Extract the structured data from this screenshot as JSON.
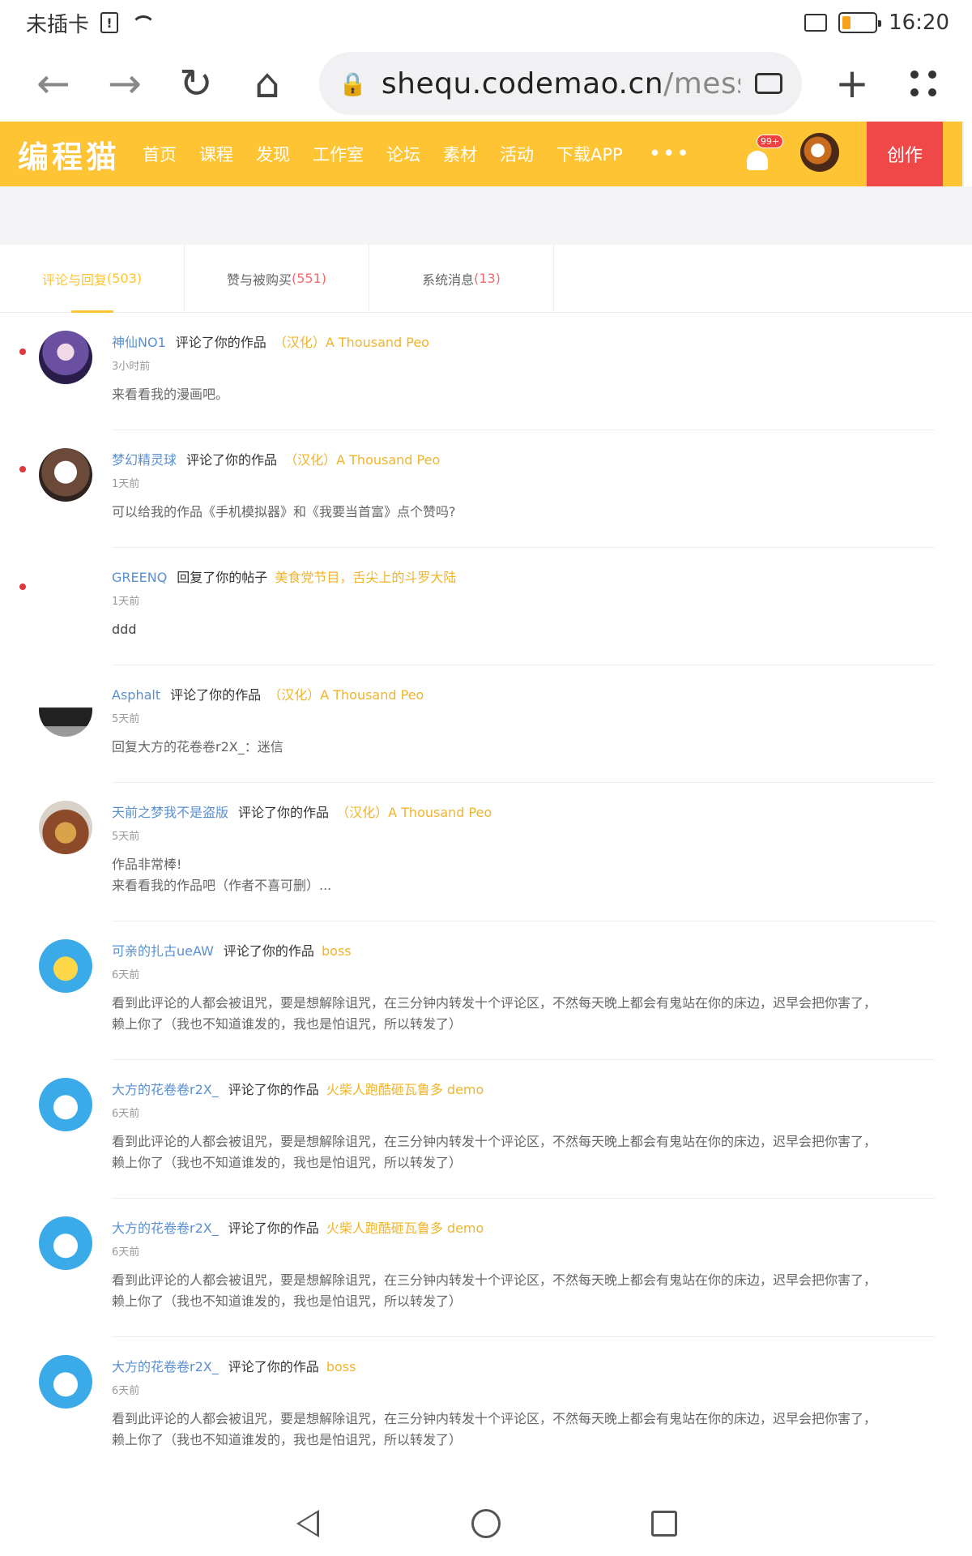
{
  "status_bar": {
    "carrier": "未插卡",
    "time": "16:20",
    "battery_fraction": 0.25
  },
  "browser": {
    "url_host": "shequ.codemao.cn",
    "url_path": "/messag"
  },
  "site_nav": {
    "logo": "编程猫",
    "items": [
      "首页",
      "课程",
      "发现",
      "工作室",
      "论坛",
      "素材",
      "活动",
      "下载APP"
    ],
    "more": "•••",
    "badge": "99+",
    "create": "创作"
  },
  "tabs": [
    {
      "label": "评论与回复",
      "count": "(503)"
    },
    {
      "label": "赞与被购买",
      "count": "(551)"
    },
    {
      "label": "系统消息",
      "count": "(13)"
    }
  ],
  "messages": [
    {
      "user": "神仙NO1",
      "action": "评论了你的作品",
      "target": "（汉化）A Thousand Peo",
      "time": "3小时前",
      "body": [
        "来看看我的漫画吧。"
      ],
      "unread": true,
      "avatar": "anime-avatar"
    },
    {
      "user": "梦幻精灵球",
      "action": "评论了你的作品",
      "target": "（汉化）A Thousand Peo",
      "time": "1天前",
      "body": [
        "可以给我的作品《手机模拟器》和《我要当首富》点个赞吗?"
      ],
      "unread": true,
      "avatar": "cartoon-avatar"
    },
    {
      "user": "GREENQ",
      "action": "回复了你的帖子",
      "target": "美食党节目，舌尖上的斗罗大陆",
      "time": "1天前",
      "body": [
        "ddd"
      ],
      "unread": true,
      "avatar": "none"
    },
    {
      "user": "Asphalt",
      "action": "评论了你的作品",
      "target": "（汉化）A Thousand Peo",
      "time": "5天前",
      "body": [
        "回复大方的花卷卷r2X_：迷信"
      ],
      "unread": false,
      "avatar": "asphalt-avatar"
    },
    {
      "user": "天前之梦我不是盗版",
      "action": "评论了你的作品",
      "target": "（汉化）A Thousand Peo",
      "time": "5天前",
      "body": [
        "作品非常棒!",
        "来看看我的作品吧（作者不喜可删）..."
      ],
      "unread": false,
      "avatar": "scene-avatar"
    },
    {
      "user": "可亲的扎古ueAW",
      "action": "评论了你的作品",
      "target": "boss",
      "time": "6天前",
      "body": [
        "看到此评论的人都会被诅咒，要是想解除诅咒，在三分钟内转发十个评论区，不然每天晚上都会有鬼站在你的床边，迟早会把你害了，",
        "赖上你了（我也不知道谁发的，我也是怕诅咒，所以转发了）"
      ],
      "unread": false,
      "avatar": "mascot-blue"
    },
    {
      "user": "大方的花卷卷r2X_",
      "action": "评论了你的作品",
      "target": "火柴人跑酷砸瓦鲁多 demo",
      "time": "6天前",
      "body": [
        "看到此评论的人都会被诅咒，要是想解除诅咒，在三分钟内转发十个评论区，不然每天晚上都会有鬼站在你的床边，迟早会把你害了，",
        "赖上你了（我也不知道谁发的，我也是怕诅咒，所以转发了）"
      ],
      "unread": false,
      "avatar": "mascot-cat"
    },
    {
      "user": "大方的花卷卷r2X_",
      "action": "评论了你的作品",
      "target": "火柴人跑酷砸瓦鲁多 demo",
      "time": "6天前",
      "body": [
        "看到此评论的人都会被诅咒，要是想解除诅咒，在三分钟内转发十个评论区，不然每天晚上都会有鬼站在你的床边，迟早会把你害了，",
        "赖上你了（我也不知道谁发的，我也是怕诅咒，所以转发了）"
      ],
      "unread": false,
      "avatar": "mascot-cat"
    },
    {
      "user": "大方的花卷卷r2X_",
      "action": "评论了你的作品",
      "target": "boss",
      "time": "6天前",
      "body": [
        "看到此评论的人都会被诅咒，要是想解除诅咒，在三分钟内转发十个评论区，不然每天晚上都会有鬼站在你的床边，迟早会把你害了，",
        "赖上你了（我也不知道谁发的，我也是怕诅咒，所以转发了）"
      ],
      "unread": false,
      "avatar": "mascot-cat"
    }
  ],
  "colors": {
    "brand": "#fec433",
    "create": "#f04848",
    "user_link": "#5a8fd0",
    "work_link": "#f0b429",
    "unread_dot": "#e0373c"
  }
}
